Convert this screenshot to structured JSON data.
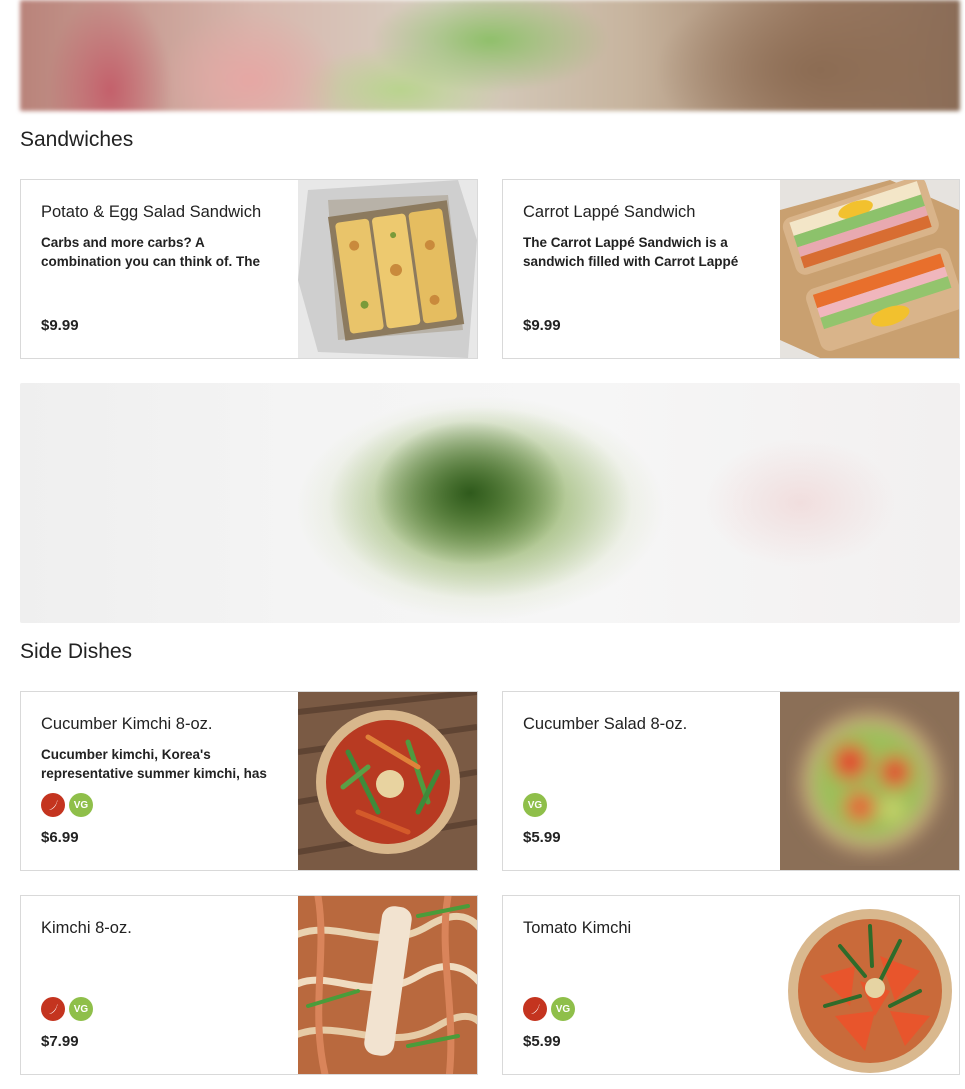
{
  "sections": [
    {
      "title": "Sandwiches",
      "items": [
        {
          "name": "Potato & Egg Salad Sandwich",
          "description": "Carbs and more carbs? A combination you can think of. The",
          "price": "$9.99",
          "badges": []
        },
        {
          "name": "Carrot Lappé Sandwich",
          "description": "The Carrot Lappé Sandwich is a sandwich filled with Carrot Lappé",
          "price": "$9.99",
          "badges": []
        }
      ]
    },
    {
      "title": "Side Dishes",
      "items": [
        {
          "name": "Cucumber Kimchi 8-oz.",
          "description": "Cucumber kimchi, Korea's representative summer kimchi, has",
          "price": "$6.99",
          "badges": [
            "spicy-icon",
            "vegan-icon"
          ]
        },
        {
          "name": "Cucumber Salad 8-oz.",
          "description": "",
          "price": "$5.99",
          "badges": [
            "vegan-icon"
          ]
        },
        {
          "name": "Kimchi 8-oz.",
          "description": "",
          "price": "$7.99",
          "badges": [
            "spicy-icon",
            "vegan-icon"
          ]
        },
        {
          "name": "Tomato Kimchi",
          "description": "",
          "price": "$5.99",
          "badges": [
            "spicy-icon",
            "vegan-icon"
          ]
        }
      ]
    }
  ],
  "badge_labels": {
    "vegan": "VG"
  },
  "colors": {
    "spicy": "#c4341f",
    "vegan": "#8fbf4a",
    "border": "#d9d9d9"
  }
}
